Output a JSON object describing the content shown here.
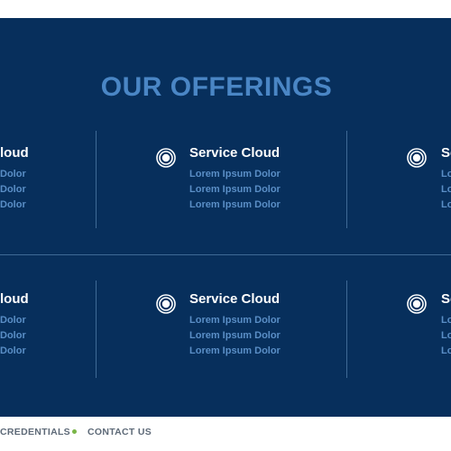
{
  "section": {
    "heading": "OUR OFFERINGS"
  },
  "cards": {
    "title": "Service Cloud",
    "title_partial": "loud",
    "title_partial_right": "Se",
    "item": "Lorem Ipsum Dolor",
    "item_partial_left": "Dolor",
    "item_partial_right": "Lo"
  },
  "footer": {
    "link_credentials": "CREDENTIALS",
    "link_contact": "CONTACT US"
  },
  "colors": {
    "background": "#072f5c",
    "heading": "#4a86c5",
    "item_text": "#5a8ec6",
    "accent_dot": "#7ab648"
  },
  "icons": {
    "card_icon": "concentric-circle-icon"
  }
}
